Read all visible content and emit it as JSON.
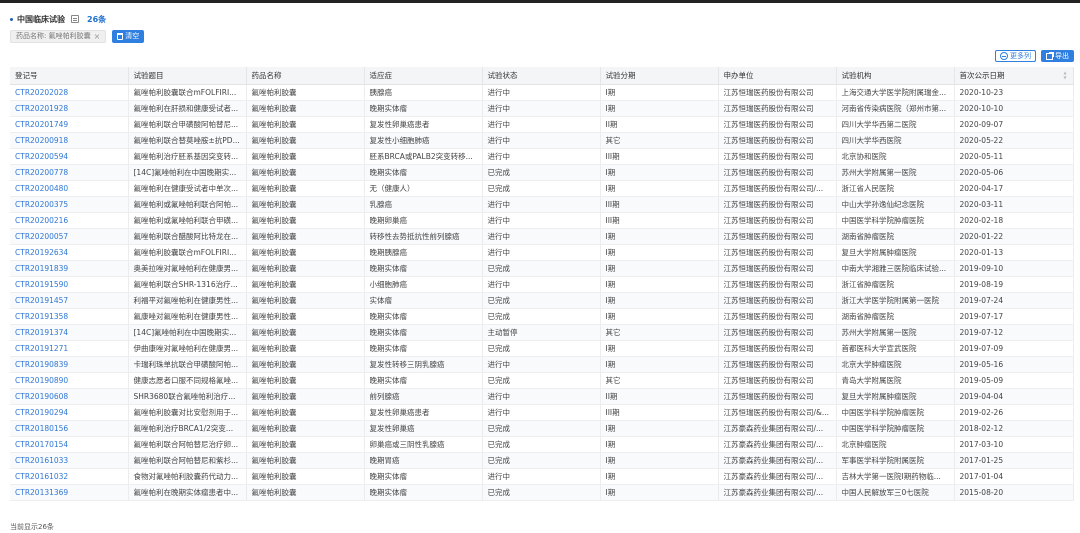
{
  "header": {
    "title": "中国临床试验",
    "count": "26条"
  },
  "filter": {
    "tag_label": "药品名称: 氟唑帕利胶囊",
    "close_glyph": "×",
    "clear_label": "清空"
  },
  "actions": {
    "more_cols": "更多列",
    "export": "导出"
  },
  "table": {
    "headers": [
      "登记号",
      "试验题目",
      "药品名称",
      "适应症",
      "试验状态",
      "试验分期",
      "申办单位",
      "试验机构",
      "首次公示日期"
    ],
    "rows": [
      [
        "CTR20202028",
        "氟唑帕利胶囊联合mFOLFIRI...",
        "氟唑帕利胶囊",
        "胰腺癌",
        "进行中",
        "I期",
        "江苏恒瑞医药股份有限公司",
        "上海交通大学医学院附属瑞金...",
        "2020-10-23"
      ],
      [
        "CTR20201928",
        "氟唑帕利在肝损和健康受试者...",
        "氟唑帕利胶囊",
        "晚期实体瘤",
        "进行中",
        "I期",
        "江苏恒瑞医药股份有限公司",
        "河南省传染病医院（郑州市第...",
        "2020-10-10"
      ],
      [
        "CTR20201749",
        "氟唑帕利联合甲磺酸阿帕替尼...",
        "氟唑帕利胶囊",
        "复发性卵巢癌患者",
        "进行中",
        "II期",
        "江苏恒瑞医药股份有限公司",
        "四川大学华西第二医院",
        "2020-09-07"
      ],
      [
        "CTR20200918",
        "氟唑帕利联合替莫唑胺±抗PD...",
        "氟唑帕利胶囊",
        "复发性小细胞肺癌",
        "进行中",
        "其它",
        "江苏恒瑞医药股份有限公司",
        "四川大学华西医院",
        "2020-05-22"
      ],
      [
        "CTR20200594",
        "氟唑帕利治疗胚系基因突变转...",
        "氟唑帕利胶囊",
        "胚系BRCA或PALB2突变转移...",
        "进行中",
        "III期",
        "江苏恒瑞医药股份有限公司",
        "北京协和医院",
        "2020-05-11"
      ],
      [
        "CTR20200778",
        "[14C]氟唑帕利在中国晚期实...",
        "氟唑帕利胶囊",
        "晚期实体瘤",
        "已完成",
        "I期",
        "江苏恒瑞医药股份有限公司",
        "苏州大学附属第一医院",
        "2020-05-06"
      ],
      [
        "CTR20200480",
        "氟唑帕利在健康受试者中单次...",
        "氟唑帕利胶囊",
        "无（健康人）",
        "已完成",
        "I期",
        "江苏恒瑞医药股份有限公司/...",
        "浙江省人民医院",
        "2020-04-17"
      ],
      [
        "CTR20200375",
        "氟唑帕利或氟唑帕利联合阿帕...",
        "氟唑帕利胶囊",
        "乳腺癌",
        "进行中",
        "III期",
        "江苏恒瑞医药股份有限公司",
        "中山大学孙逸仙纪念医院",
        "2020-03-11"
      ],
      [
        "CTR20200216",
        "氟唑帕利或氟唑帕利联合甲磺...",
        "氟唑帕利胶囊",
        "晚期卵巢癌",
        "进行中",
        "III期",
        "江苏恒瑞医药股份有限公司",
        "中国医学科学院肿瘤医院",
        "2020-02-18"
      ],
      [
        "CTR20200057",
        "氟唑帕利联合醋酸阿比特龙在...",
        "氟唑帕利胶囊",
        "转移性去势抵抗性前列腺癌",
        "进行中",
        "I期",
        "江苏恒瑞医药股份有限公司",
        "湖南省肿瘤医院",
        "2020-01-22"
      ],
      [
        "CTR20192634",
        "氟唑帕利胶囊联合mFOLFIRI...",
        "氟唑帕利胶囊",
        "晚期胰腺癌",
        "进行中",
        "I期",
        "江苏恒瑞医药股份有限公司",
        "复旦大学附属肿瘤医院",
        "2020-01-13"
      ],
      [
        "CTR20191839",
        "奥美拉唑对氟唑帕利在健康男...",
        "氟唑帕利胶囊",
        "晚期实体瘤",
        "已完成",
        "I期",
        "江苏恒瑞医药股份有限公司",
        "中南大学湘雅三医院临床试验...",
        "2019-09-10"
      ],
      [
        "CTR20191590",
        "氟唑帕利联合SHR-1316治疗...",
        "氟唑帕利胶囊",
        "小细胞肺癌",
        "进行中",
        "I期",
        "江苏恒瑞医药股份有限公司",
        "浙江省肿瘤医院",
        "2019-08-19"
      ],
      [
        "CTR20191457",
        "利福平对氟唑帕利在健康男性...",
        "氟唑帕利胶囊",
        "实体瘤",
        "已完成",
        "I期",
        "江苏恒瑞医药股份有限公司",
        "浙江大学医学院附属第一医院",
        "2019-07-24"
      ],
      [
        "CTR20191358",
        "氟康唑对氟唑帕利在健康男性...",
        "氟唑帕利胶囊",
        "晚期实体瘤",
        "已完成",
        "I期",
        "江苏恒瑞医药股份有限公司",
        "湖南省肿瘤医院",
        "2019-07-17"
      ],
      [
        "CTR20191374",
        "[14C]氟唑帕利在中国晚期实...",
        "氟唑帕利胶囊",
        "晚期实体瘤",
        "主动暂停",
        "其它",
        "江苏恒瑞医药股份有限公司",
        "苏州大学附属第一医院",
        "2019-07-12"
      ],
      [
        "CTR20191271",
        "伊曲康唑对氟唑帕利在健康男...",
        "氟唑帕利胶囊",
        "晚期实体瘤",
        "已完成",
        "I期",
        "江苏恒瑞医药股份有限公司",
        "首都医科大学宣武医院",
        "2019-07-09"
      ],
      [
        "CTR20190839",
        "卡瑞利珠单抗联合甲磺酸阿帕...",
        "氟唑帕利胶囊",
        "复发性转移三阴乳腺癌",
        "进行中",
        "I期",
        "江苏恒瑞医药股份有限公司",
        "北京大学肿瘤医院",
        "2019-05-16"
      ],
      [
        "CTR20190890",
        "健康志愿者口服不同规格氟唑...",
        "氟唑帕利胶囊",
        "晚期实体瘤",
        "已完成",
        "其它",
        "江苏恒瑞医药股份有限公司",
        "青岛大学附属医院",
        "2019-05-09"
      ],
      [
        "CTR20190608",
        "SHR3680联合氟唑帕利治疗...",
        "氟唑帕利胶囊",
        "前列腺癌",
        "进行中",
        "II期",
        "江苏恒瑞医药股份有限公司",
        "复旦大学附属肿瘤医院",
        "2019-04-04"
      ],
      [
        "CTR20190294",
        "氟唑帕利胶囊对比安慰剂用于...",
        "氟唑帕利胶囊",
        "复发性卵巢癌患者",
        "进行中",
        "III期",
        "江苏恒瑞医药股份有限公司/&...",
        "中国医学科学院肿瘤医院",
        "2019-02-26"
      ],
      [
        "CTR20180156",
        "氟唑帕利治疗BRCA1/2突变...",
        "氟唑帕利胶囊",
        "复发性卵巢癌",
        "已完成",
        "I期",
        "江苏豪森药业集团有限公司/...",
        "中国医学科学院肿瘤医院",
        "2018-02-12"
      ],
      [
        "CTR20170154",
        "氟唑帕利联合阿帕替尼治疗卵...",
        "氟唑帕利胶囊",
        "卵巢癌或三阴性乳腺癌",
        "已完成",
        "I期",
        "江苏豪森药业集团有限公司/...",
        "北京肿瘤医院",
        "2017-03-10"
      ],
      [
        "CTR20161033",
        "氟唑帕利联合阿帕替尼和紫杉...",
        "氟唑帕利胶囊",
        "晚期胃癌",
        "已完成",
        "I期",
        "江苏豪森药业集团有限公司/...",
        "军事医学科学院附属医院",
        "2017-01-25"
      ],
      [
        "CTR20161032",
        "食物对氟唑帕利胶囊药代动力...",
        "氟唑帕利胶囊",
        "晚期实体瘤",
        "进行中",
        "I期",
        "江苏豪森药业集团有限公司/...",
        "吉林大学第一医院I期药物临...",
        "2017-01-04"
      ],
      [
        "CTR20131369",
        "氟唑帕利在晚期实体瘤患者中...",
        "氟唑帕利胶囊",
        "晚期实体瘤",
        "已完成",
        "I期",
        "江苏豪森药业集团有限公司/...",
        "中国人民解放军三0七医院",
        "2015-08-20"
      ]
    ]
  },
  "footer": {
    "summary": "当前显示26条"
  },
  "icons": {
    "title_icon": "list-icon",
    "clear_icon": "trash-icon",
    "more_icon": "minus-circle-icon",
    "export_icon": "export-icon",
    "sort_icon": "sort-icon"
  },
  "colors": {
    "accent": "#2f7fe0",
    "link": "#2f78d6"
  }
}
